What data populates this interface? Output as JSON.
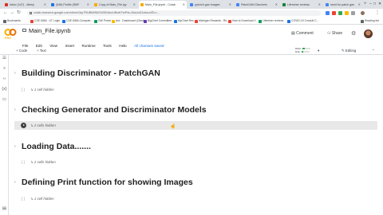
{
  "browser": {
    "tabs": [
      {
        "label": "Inbox (147) - dileep",
        "color": "#d93025"
      },
      {
        "label": "(548) Profile (SMF",
        "color": "#1a73e8"
      },
      {
        "label": "Copy of Main_File.ipy",
        "color": "#f9ab00"
      },
      {
        "label": "Main_File.ipynb - Colab",
        "color": "#f9ab00",
        "active": true
      },
      {
        "label": "pytorch gan images",
        "color": "#4285f4"
      },
      {
        "label": "PatchGAN Discrimin",
        "color": "#4285f4"
      },
      {
        "label": "Lifeminer reviews",
        "color": "#188038"
      },
      {
        "label": "need for patch gan",
        "color": "#4285f4"
      }
    ],
    "new_tab": "+",
    "window_controls": [
      "–",
      "□",
      "✕"
    ],
    "url": "colab.research.google.com/drive/1bp7RUBMtS6GW9DUkcUBwKTwP4u-MuUoD1#scrollTo=...",
    "bookmarks": [
      {
        "label": "Bookmarks",
        "color": "#5f6368"
      },
      {
        "label": "CSE 6366 - UT Login",
        "color": "#ea4335"
      },
      {
        "label": "CSE 6366-Compute...",
        "color": "#1a73e8"
      },
      {
        "label": "GW Portal",
        "color": "#0f9d58"
      },
      {
        "label": "Ard - Dashboard (Ctest)",
        "color": "#fbbc04"
      },
      {
        "label": "BigChief Committee...",
        "color": "#673ab7"
      },
      {
        "label": "MyChart Rec",
        "color": "#1a73e8"
      },
      {
        "label": "Michigan Rewards - Re...",
        "color": "#ea4335"
      },
      {
        "label": "How to Download Y...",
        "color": "#ea4335"
      },
      {
        "label": "Lifeminer reviews",
        "color": "#0f9d58"
      },
      {
        "label": "COVID-19 Consult C...",
        "color": "#1a73e8"
      },
      {
        "label": "Reading list",
        "color": "#5f6368"
      }
    ]
  },
  "colab": {
    "logo_text": "PRO",
    "file_name": "Main_File.ipynb",
    "menu": [
      "File",
      "Edit",
      "View",
      "Insert",
      "Runtime",
      "Tools",
      "Help"
    ],
    "save_status": "All changes saved",
    "comment_label": "Comment",
    "share_label": "Share",
    "toolbar": {
      "add_code": "+ Code",
      "add_text": "+ Text",
      "ram_label": "RAM",
      "disk_label": "Disk",
      "ram_usage": 0.35,
      "disk_usage": 0.2,
      "editing_label": "Editing"
    }
  },
  "sections": [
    {
      "title": "Building Discriminator - PatchGAN",
      "hidden": "1 cell hidden",
      "selected": false
    },
    {
      "title": "Checking Generator and Discriminator Models",
      "hidden": "2 cells hidden",
      "selected": true
    },
    {
      "title": "Loading Data.......",
      "hidden": "2 cells hidden",
      "selected": false
    },
    {
      "title": "Defining Print function for showing Images",
      "hidden": "1 cell hidden",
      "selected": false
    }
  ]
}
